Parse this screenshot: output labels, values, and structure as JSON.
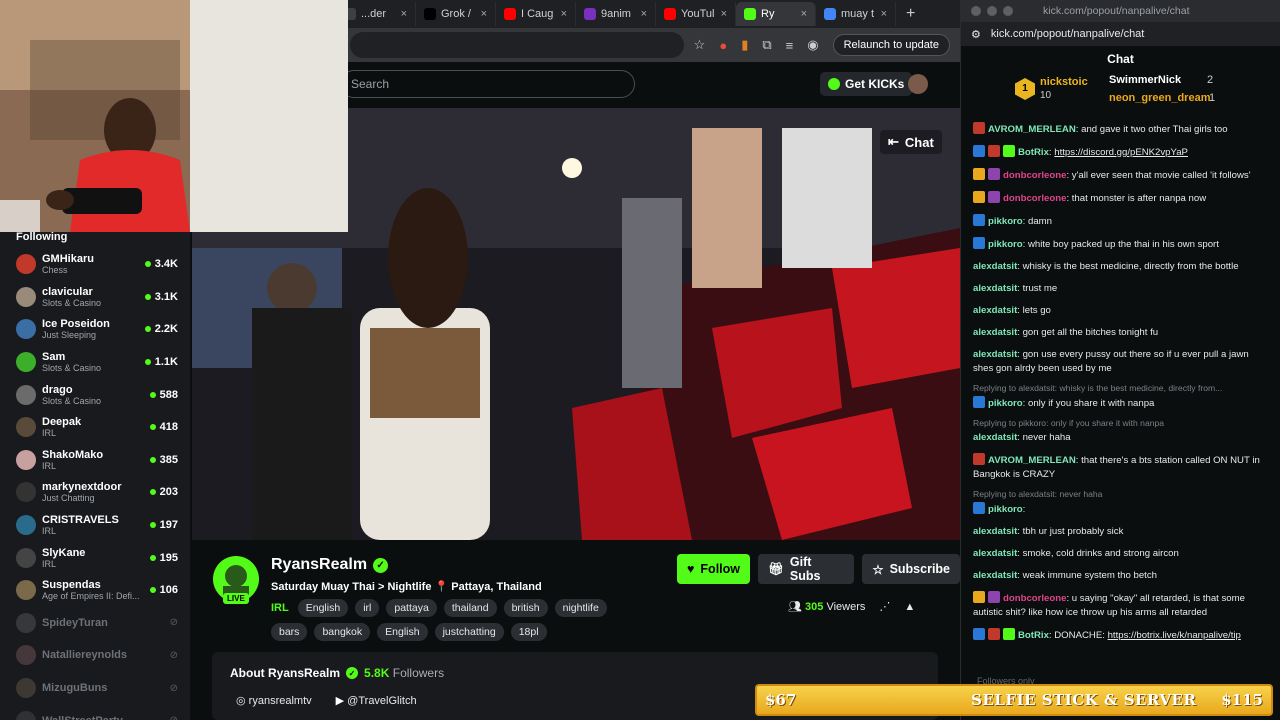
{
  "tabs": [
    {
      "label": "...der",
      "icon": "page-icon",
      "color": "#3c4043"
    },
    {
      "label": "Grok /",
      "icon": "x-logo-icon",
      "color": "#000000"
    },
    {
      "label": "I Caug",
      "icon": "youtube-icon",
      "color": "#ff0000"
    },
    {
      "label": "9anim",
      "icon": "anime-site-icon",
      "color": "#7b2fbe"
    },
    {
      "label": "YouTul",
      "icon": "youtube-icon",
      "color": "#ff0000"
    },
    {
      "label": "Ry",
      "icon": "kick-icon",
      "color": "#53fc18",
      "active": true
    },
    {
      "label": "muay t",
      "icon": "google-icon",
      "color": "#4285f4"
    }
  ],
  "browser": {
    "relaunch_label": "Relaunch to update",
    "new_tab": "+"
  },
  "kick": {
    "search_placeholder": "Search",
    "get_kicks": "Get KICKs",
    "chat_toggle": "Chat"
  },
  "sidebar": {
    "heading": "Following",
    "items": [
      {
        "name": "GMHikaru",
        "category": "Chess",
        "viewers": "3.4K",
        "live": true,
        "color": "#c0392b"
      },
      {
        "name": "clavicular",
        "category": "Slots & Casino",
        "viewers": "3.1K",
        "live": true,
        "color": "#9a8a7a"
      },
      {
        "name": "Ice Poseidon",
        "category": "Just Sleeping",
        "viewers": "2.2K",
        "live": true,
        "color": "#3a6ea5"
      },
      {
        "name": "Sam",
        "category": "Slots & Casino",
        "viewers": "1.1K",
        "live": true,
        "color": "#3cae2a"
      },
      {
        "name": "drago",
        "category": "Slots & Casino",
        "viewers": "588",
        "live": true,
        "color": "#6b6b6b"
      },
      {
        "name": "Deepak",
        "category": "IRL",
        "viewers": "418",
        "live": true,
        "color": "#5a4a3a"
      },
      {
        "name": "ShakoMako",
        "category": "IRL",
        "viewers": "385",
        "live": true,
        "color": "#c9a0a0"
      },
      {
        "name": "markynextdoor",
        "category": "Just Chatting",
        "viewers": "203",
        "live": true,
        "color": "#333333"
      },
      {
        "name": "CRISTRAVELS",
        "category": "IRL",
        "viewers": "197",
        "live": true,
        "color": "#2a6a8a"
      },
      {
        "name": "SlyKane",
        "category": "IRL",
        "viewers": "195",
        "live": true,
        "color": "#444444"
      },
      {
        "name": "Suspendas",
        "category": "Age of Empires II: Defi...",
        "viewers": "106",
        "live": true,
        "color": "#7a6a4a"
      },
      {
        "name": "SpideyTuran",
        "category": "",
        "viewers": "",
        "live": false,
        "color": "#666666"
      },
      {
        "name": "Natalliereynolds",
        "category": "",
        "viewers": "",
        "live": false,
        "color": "#886666"
      },
      {
        "name": "MizuguBuns",
        "category": "",
        "viewers": "",
        "live": false,
        "color": "#776655"
      },
      {
        "name": "WallStreetParty",
        "category": "",
        "viewers": "",
        "live": false,
        "color": "#555555"
      }
    ]
  },
  "channel": {
    "name": "RyansRealm",
    "live_badge": "LIVE",
    "title": "Saturday Muay Thai > Nightlife 📍 Pattaya, Thailand",
    "category": "IRL",
    "tags": [
      "English",
      "irl",
      "pattaya",
      "thailand",
      "british",
      "nightlife",
      "bars",
      "bangkok",
      "English",
      "justchatting",
      "18pl"
    ],
    "follow": "Follow",
    "gift": "Gift Subs",
    "subscribe": "Subscribe",
    "viewers": "305",
    "viewers_label": "Viewers",
    "about_title": "About RyansRealm",
    "followers": "5.8K",
    "followers_label": "Followers",
    "instagram": "ryansrealmtv",
    "youtube": "@TravelGlitch"
  },
  "popout": {
    "window_title": "kick.com/popout/nanpalive/chat",
    "url": "kick.com/popout/nanpalive/chat",
    "header": "Chat",
    "leaders": [
      {
        "name": "nickstoic",
        "count": "10",
        "rank": "1"
      },
      {
        "name": "SwimmerNick",
        "count": "2"
      },
      {
        "name": "neon_green_dream",
        "count": "1"
      }
    ],
    "messages": [
      {
        "user": "AVROM_MERLEAN",
        "color": "#7ee8b8",
        "text": ": and gave it two other Thai girls too",
        "badges": [
          "#c0392b"
        ]
      },
      {
        "user": "BotRix",
        "color": "#7ee8b8",
        "text": ": ",
        "link": "https://discord.gg/pENK2vpYaP",
        "badges": [
          "#2a78d6",
          "#c0392b",
          "#53fc18"
        ]
      },
      {
        "user": "donbcorleone",
        "color": "#e0448a",
        "text": ": y'all ever seen that movie called 'it follows'",
        "badges": [
          "#e9a81e",
          "#8e44ad"
        ]
      },
      {
        "user": "donbcorleone",
        "color": "#e0448a",
        "text": ": that monster is after nanpa now",
        "badges": [
          "#e9a81e",
          "#8e44ad"
        ]
      },
      {
        "user": "pikkoro",
        "color": "#7ee8b8",
        "text": ": damn",
        "badges": [
          "#2a78d6"
        ]
      },
      {
        "user": "pikkoro",
        "color": "#7ee8b8",
        "text": ": white boy packed up the thai in his own sport",
        "badges": [
          "#2a78d6"
        ]
      },
      {
        "user": "alexdatsit",
        "color": "#7ee8b8",
        "text": ": whisky is the best medicine, directly from the bottle",
        "badges": []
      },
      {
        "user": "alexdatsit",
        "color": "#7ee8b8",
        "text": ": trust me",
        "badges": []
      },
      {
        "user": "alexdatsit",
        "color": "#7ee8b8",
        "text": ": lets go",
        "badges": []
      },
      {
        "user": "alexdatsit",
        "color": "#7ee8b8",
        "text": ": gon get all the bitches tonight fu",
        "badges": []
      },
      {
        "user": "alexdatsit",
        "color": "#7ee8b8",
        "text": ": gon use every pussy out there so if u ever pull a jawn shes gon alrdy been used by me",
        "badges": []
      },
      {
        "reply": "Replying to alexdatsit: whisky is the best medicine, directly from...",
        "user": "pikkoro",
        "color": "#7ee8b8",
        "text": ": only if you share it with nanpa",
        "badges": [
          "#2a78d6"
        ]
      },
      {
        "reply": "Replying to pikkoro: only if you share it with nanpa",
        "user": "alexdatsit",
        "color": "#7ee8b8",
        "text": ": never haha",
        "badges": []
      },
      {
        "user": "AVROM_MERLEAN",
        "color": "#7ee8b8",
        "text": ": that there's a bts station called ON NUT in Bangkok is CRAZY",
        "badges": [
          "#c0392b"
        ]
      },
      {
        "reply": "Replying to alexdatsit: never haha",
        "user": "pikkoro",
        "color": "#7ee8b8",
        "text": ":",
        "badges": [
          "#2a78d6"
        ]
      },
      {
        "user": "alexdatsit",
        "color": "#7ee8b8",
        "text": ": tbh ur just probably sick",
        "badges": []
      },
      {
        "user": "alexdatsit",
        "color": "#7ee8b8",
        "text": ": smoke, cold drinks and strong aircon",
        "badges": []
      },
      {
        "user": "alexdatsit",
        "color": "#7ee8b8",
        "text": ": weak immune system tho betch",
        "badges": []
      },
      {
        "user": "donbcorleone",
        "color": "#e0448a",
        "text": ": u saying \"okay\" all retarded, is that some autistic shit? like how ice throw up his arms all retarded",
        "badges": [
          "#e9a81e",
          "#8e44ad"
        ]
      },
      {
        "user": "BotRix",
        "color": "#7ee8b8",
        "text": ": DONACHE: ",
        "link": "https://botrix.live/k/nanpalive/tip",
        "badges": [
          "#2a78d6",
          "#c0392b",
          "#53fc18"
        ]
      }
    ],
    "footer_hint": "Followers only"
  },
  "goal_banner": {
    "left": "$67",
    "middle": "SELFIE STICK & SERVER",
    "right": "$115",
    "progress": 0.58
  }
}
